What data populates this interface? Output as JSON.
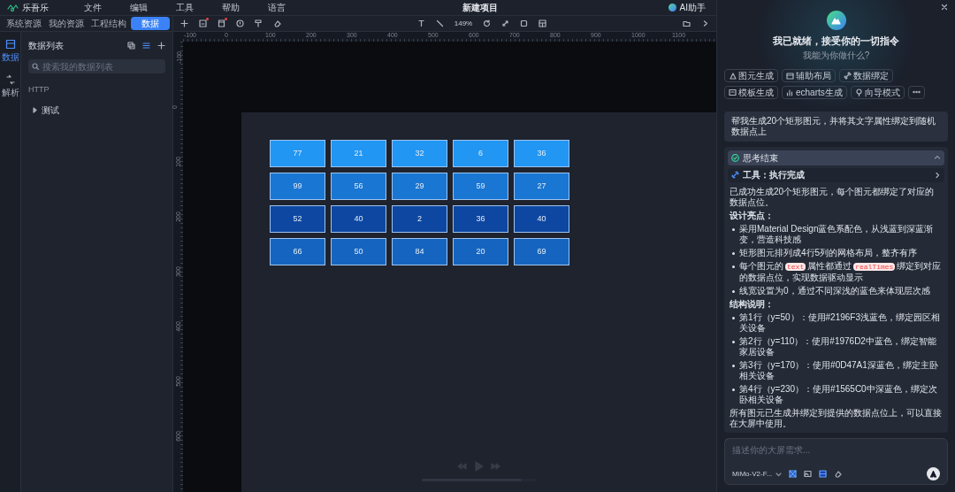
{
  "menu_bar": {
    "logo": "乐吾乐",
    "items": [
      "文件",
      "编辑",
      "工具",
      "帮助",
      "语言"
    ],
    "title": "新建项目",
    "assistant": "AI助手"
  },
  "source_tabs": [
    {
      "label": "系统资源",
      "selected": false
    },
    {
      "label": "我的资源",
      "selected": false
    },
    {
      "label": "工程结构",
      "selected": false
    },
    {
      "label": "数据",
      "selected": true
    }
  ],
  "rail": [
    {
      "label": "数据",
      "selected": true
    },
    {
      "label": "解析",
      "selected": false
    }
  ],
  "data_panel": {
    "title": "数据列表",
    "search": {
      "placeholder": "搜索我的数据列表"
    },
    "group": "HTTP",
    "items": [
      {
        "label": "测试",
        "expanded": false
      }
    ]
  },
  "toolbar": {
    "zoom": "149%"
  },
  "rulers": {
    "horizontal": [
      "-100",
      "0",
      "100",
      "200",
      "300",
      "400",
      "500",
      "600",
      "700",
      "800",
      "900",
      "1000",
      "1100"
    ],
    "vertical": [
      "-100",
      "0",
      "100",
      "200",
      "300",
      "400",
      "500",
      "600"
    ]
  },
  "canvas": {
    "rows": [
      {
        "color": "#2196f3",
        "values": [
          "77",
          "21",
          "32",
          "6",
          "36"
        ]
      },
      {
        "color": "#1976d2",
        "values": [
          "99",
          "56",
          "29",
          "59",
          "27"
        ]
      },
      {
        "color": "#0d47a1",
        "values": [
          "52",
          "40",
          "2",
          "36",
          "40"
        ]
      },
      {
        "color": "#1565c0",
        "values": [
          "66",
          "50",
          "84",
          "20",
          "69"
        ]
      }
    ]
  },
  "player": {
    "level": 0.87
  },
  "assistant_panel": {
    "heading": "我已就绪，接受你的一切指令",
    "subheading": "我能为你做什么?",
    "chips": [
      "图元生成",
      "辅助布局",
      "数据绑定",
      "模板生成",
      "echarts生成",
      "向导模式"
    ],
    "user_message": "帮我生成20个矩形图元，并将其文字属性绑定到随机数据点上",
    "thinking": {
      "label": "思考结束",
      "expanded": true
    },
    "tool_status": "工具：执行完成",
    "reply": [
      {
        "kind": "paragraph",
        "text": "已成功生成20个矩形图元，每个图元都绑定了对应的数据点位。"
      },
      {
        "kind": "heading",
        "text": "设计亮点："
      },
      {
        "kind": "bullet",
        "parts": [
          {
            "kind": "text",
            "text": "采用Material Design蓝色系配色，从浅蓝到深蓝渐变，营造科技感"
          }
        ]
      },
      {
        "kind": "bullet",
        "parts": [
          {
            "kind": "text",
            "text": "矩形图元排列成4行5列的网格布局，整齐有序"
          }
        ]
      },
      {
        "kind": "bullet",
        "parts": [
          {
            "kind": "text",
            "text": "每个图元的"
          },
          {
            "kind": "code",
            "text": "text"
          },
          {
            "kind": "text",
            "text": "属性都通过"
          },
          {
            "kind": "code",
            "text": "realTimes"
          },
          {
            "kind": "text",
            "text": "绑定到对应的数据点位，实现数据驱动显示"
          }
        ]
      },
      {
        "kind": "bullet",
        "parts": [
          {
            "kind": "text",
            "text": "线宽设置为0，通过不同深浅的蓝色来体现层次感"
          }
        ]
      },
      {
        "kind": "heading",
        "text": "结构说明："
      },
      {
        "kind": "bullet",
        "parts": [
          {
            "kind": "text",
            "text": "第1行（y=50）：使用#2196F3浅蓝色，绑定园区相关设备"
          }
        ]
      },
      {
        "kind": "bullet",
        "parts": [
          {
            "kind": "text",
            "text": "第2行（y=110）：使用#1976D2中蓝色，绑定智能家居设备"
          }
        ]
      },
      {
        "kind": "bullet",
        "parts": [
          {
            "kind": "text",
            "text": "第3行（y=170）：使用#0D47A1深蓝色，绑定主卧相关设备"
          }
        ]
      },
      {
        "kind": "bullet",
        "parts": [
          {
            "kind": "text",
            "text": "第4行（y=230）：使用#1565C0中深蓝色，绑定次卧相关设备"
          }
        ]
      },
      {
        "kind": "paragraph",
        "text": "所有图元已生成并绑定到提供的数据点位上，可以直接在大屏中使用。"
      }
    ],
    "input": {
      "placeholder": "描述你的大屏需求..."
    },
    "model": "MiMo-V2-F..."
  }
}
